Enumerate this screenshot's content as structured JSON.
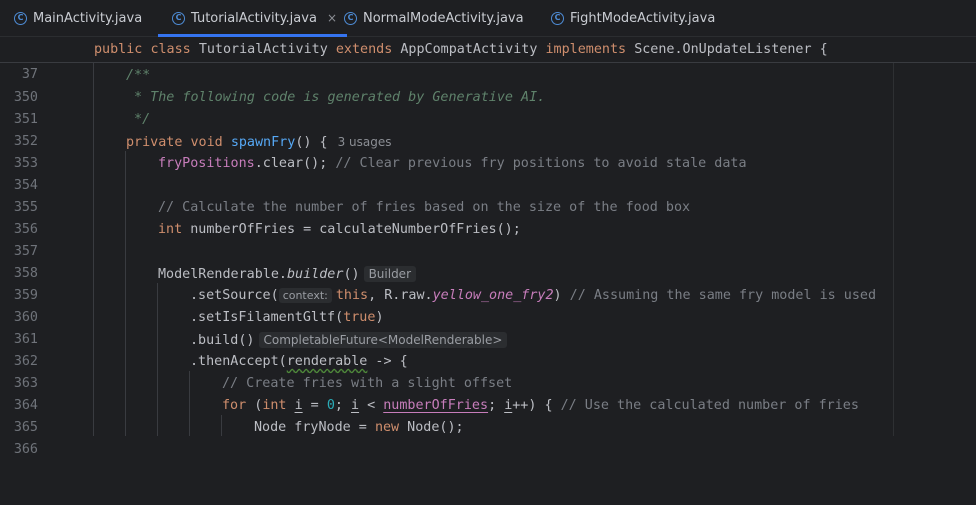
{
  "tabs": [
    {
      "label": "MainActivity.java",
      "active": false
    },
    {
      "label": "TutorialActivity.java",
      "active": true
    },
    {
      "label": "NormalModeActivity.java",
      "active": false
    },
    {
      "label": "FightModeActivity.java",
      "active": false
    }
  ],
  "tab_icon_glyph": "C",
  "tab_close_glyph": "×",
  "sticky": {
    "line": "37",
    "kw_public": "public",
    "kw_class": "class",
    "class_name": "TutorialActivity",
    "kw_extends": "extends",
    "parent": "AppCompatActivity",
    "kw_implements": "implements",
    "iface": "Scene.OnUpdateListener",
    "brace": "{"
  },
  "line_numbers": [
    "350",
    "351",
    "352",
    "353",
    "354",
    "355",
    "356",
    "357",
    "358",
    "359",
    "360",
    "361",
    "362",
    "363",
    "364",
    "365",
    "366"
  ],
  "code": {
    "l350": "/**",
    "l351": " * The following code is generated by Generative AI.",
    "l352": " */",
    "l353_private": "private",
    "l353_void": "void",
    "l353_name": "spawnFry",
    "l353_rest": "() {",
    "l353_usages": "3 usages",
    "l354_field": "fryPositions",
    "l354_rest": ".clear(); ",
    "l354_comment": "// Clear previous fry positions to avoid stale data",
    "l356_comment": "// Calculate the number of fries based on the size of the food box",
    "l357_int": "int",
    "l357_rest": " numberOfFries = calculateNumberOfFries();",
    "l359_a": "ModelRenderable.",
    "l359_b": "builder",
    "l359_c": "()",
    "l359_hint": "Builder",
    "l360_a": ".setSource(",
    "l360_hint": "context:",
    "l360_this": "this",
    "l360_b": ", R.raw.",
    "l360_res": "yellow_one_fry2",
    "l360_c": ") ",
    "l360_comment": "// Assuming the same fry model is used",
    "l361_a": ".setIsFilamentGltf(",
    "l361_true": "true",
    "l361_b": ")",
    "l362_a": ".build()",
    "l362_hint": "CompletableFuture<ModelRenderable>",
    "l363_a": ".thenAccept(",
    "l363_param": "renderable",
    "l363_b": " -> {",
    "l364_comment": "// Create fries with a slight offset",
    "l365_for": "for",
    "l365_a": " (",
    "l365_int": "int",
    "l365_sp": " ",
    "l365_i1": "i",
    "l365_eq": " = ",
    "l365_zero": "0",
    "l365_semi": "; ",
    "l365_i2": "i",
    "l365_lt": " < ",
    "l365_num": "numberOfFries",
    "l365_semi2": "; ",
    "l365_i3": "i",
    "l365_inc": "++) { ",
    "l365_comment": "// Use the calculated number of fries",
    "l366_a": "Node fryNode = ",
    "l366_new": "new",
    "l366_b": " Node();"
  },
  "colors": {
    "background": "#1e1f22",
    "keyword": "#cf8e6d",
    "method": "#56a8f5",
    "field": "#c77dbb",
    "comment": "#7a7e85",
    "doc_comment": "#5f826b",
    "number": "#2aacb8",
    "tab_accent": "#3574f0"
  }
}
